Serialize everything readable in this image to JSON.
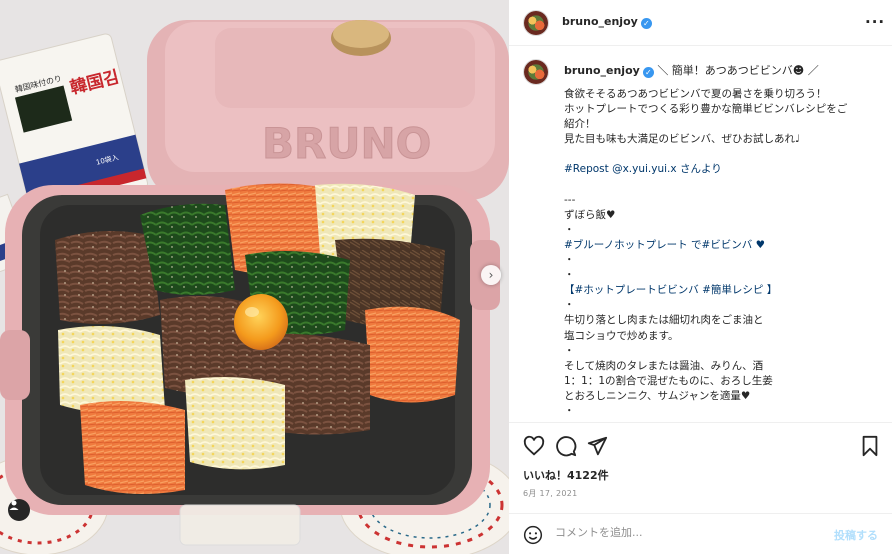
{
  "photo": {
    "lid_brand": "BRUNO",
    "seaweed_pack_title": "韓国김",
    "seaweed_pack_sub": "韓国味付のり",
    "seaweed_pack_count": "10袋入"
  },
  "header": {
    "username": "bruno_enjoy",
    "verified_icon": "verified-badge-icon"
  },
  "caption": {
    "username": "bruno_enjoy",
    "lines": [
      {
        "text": "食欲そそるあつあつビビンバで夏の暑さを乗り切ろう！",
        "link": false
      },
      {
        "text": "ホットプレートでつくる彩り豊かな簡単ビビンバレシピをご",
        "link": false
      },
      {
        "text": "紹介！",
        "link": false
      },
      {
        "text": "見た目も味も大満足のビビンバ、ぜひお試しあれ♩",
        "link": false
      },
      {
        "text": "",
        "link": false
      },
      {
        "text": "#Repost @x.yui.yui.x さんより",
        "link": true
      },
      {
        "text": "",
        "link": false
      },
      {
        "text": "---",
        "link": false
      },
      {
        "text": "ずぼら飯♥",
        "link": false
      },
      {
        "text": "・",
        "link": false
      },
      {
        "text": "#ブルーノホットプレート で#ビビンバ ♥",
        "link": true
      },
      {
        "text": "・",
        "link": false
      },
      {
        "text": "・",
        "link": false
      },
      {
        "text": "【#ホットプレートビビンバ #簡単レシピ 】",
        "link": true
      },
      {
        "text": "・",
        "link": false
      },
      {
        "text": "牛切り落とし肉または細切れ肉をごま油と",
        "link": false
      },
      {
        "text": "塩コショウで炒めます。",
        "link": false
      },
      {
        "text": "・",
        "link": false
      },
      {
        "text": "そして焼肉のタレまたは醤油、みりん、酒",
        "link": false
      },
      {
        "text": "1：1：1の割合で混ぜたものに、おろし生姜",
        "link": false
      },
      {
        "text": "とおろしニンニク、サムジャンを適量♥",
        "link": false
      },
      {
        "text": "・",
        "link": false
      },
      {
        "text": "・",
        "link": false
      }
    ]
  },
  "title_line": "＼ 簡単！あつあつビビンバ☻ ／",
  "actions": {
    "likes": "いいね！4122件",
    "date": "6月 17, 2021",
    "icons": [
      "heart-icon",
      "comment-icon",
      "share-icon",
      "bookmark-icon"
    ]
  },
  "comment": {
    "placeholder": "コメントを追加...",
    "post_label": "投稿する"
  },
  "colors": {
    "link": "#00376b",
    "post_disabled": "#b2dffc",
    "plate_pink": "#e8b7b9",
    "verified": "#3897f0"
  }
}
